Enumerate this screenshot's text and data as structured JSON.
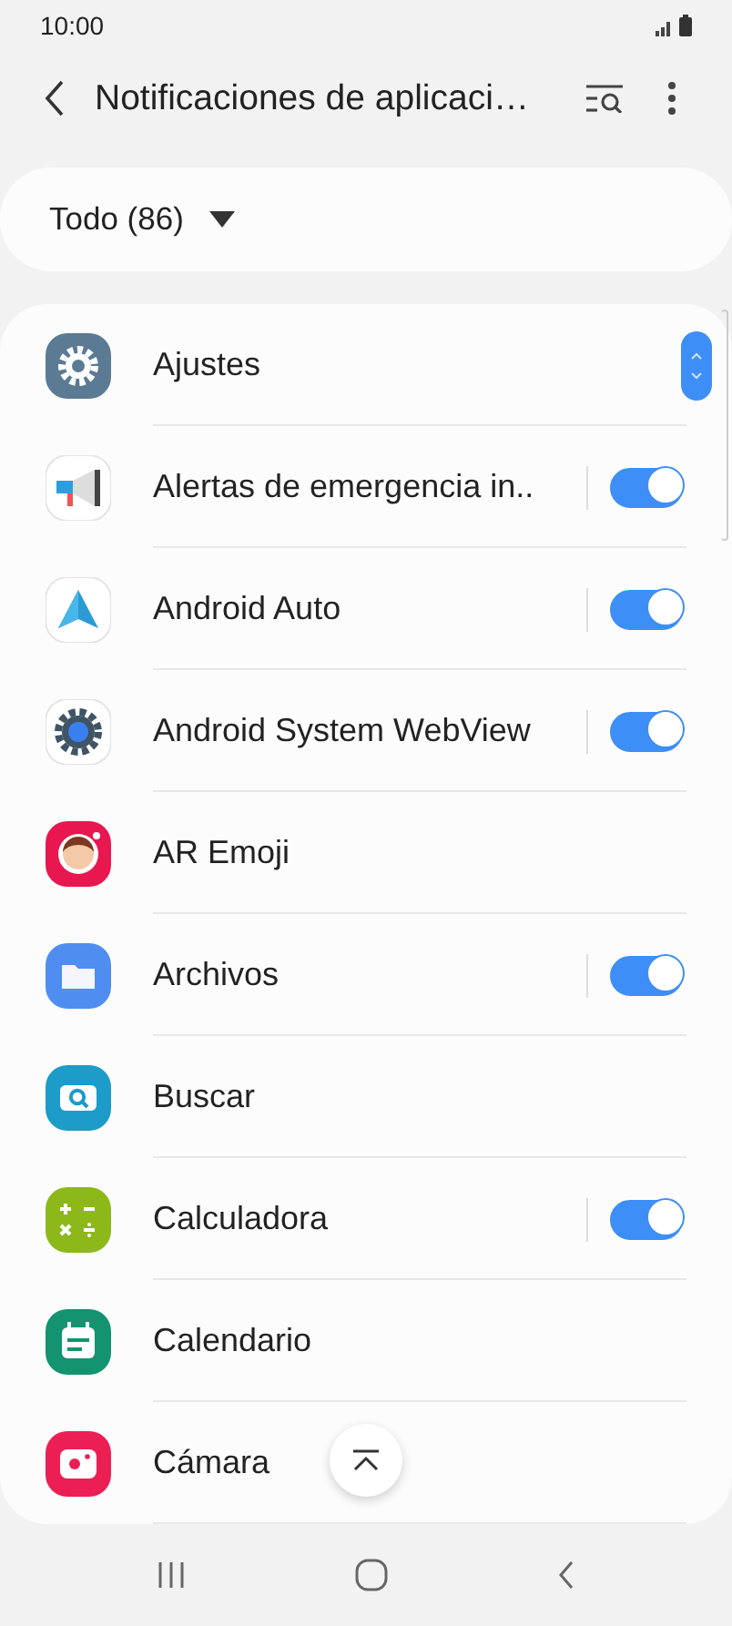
{
  "status_bar": {
    "time": "10:00"
  },
  "toolbar": {
    "title": "Notificaciones de aplicaci…"
  },
  "filter": {
    "label": "Todo (86)"
  },
  "apps": [
    {
      "name": "Ajustes",
      "kind": "plain"
    },
    {
      "name": "Alertas de emergencia in..",
      "kind": "toggle",
      "on": true
    },
    {
      "name": "Android Auto",
      "kind": "toggle",
      "on": true
    },
    {
      "name": "Android System WebView",
      "kind": "toggle",
      "on": true
    },
    {
      "name": "AR Emoji",
      "kind": "plain"
    },
    {
      "name": "Archivos",
      "kind": "toggle",
      "on": true
    },
    {
      "name": "Buscar",
      "kind": "plain"
    },
    {
      "name": "Calculadora",
      "kind": "toggle",
      "on": true
    },
    {
      "name": "Calendario",
      "kind": "plain"
    },
    {
      "name": "Cámara",
      "kind": "plain"
    }
  ]
}
